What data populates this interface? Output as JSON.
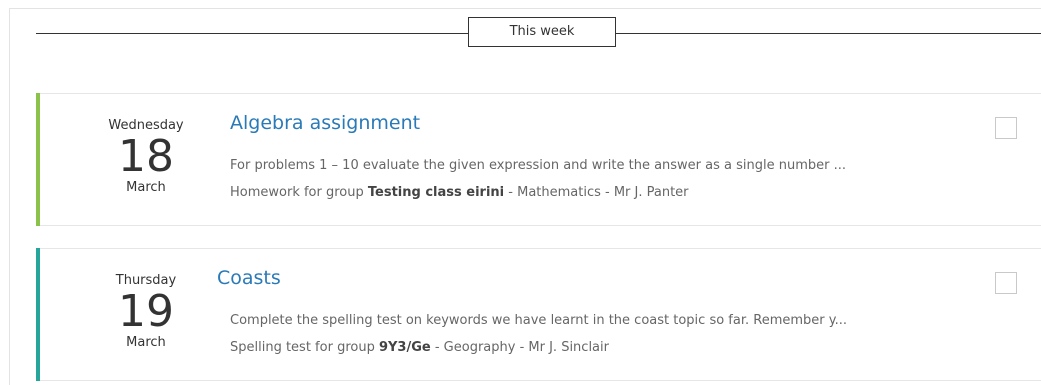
{
  "section": {
    "label": "This week"
  },
  "assignments": [
    {
      "dow": "Wednesday",
      "day": "18",
      "month": "March",
      "title": "Algebra assignment",
      "description": "For problems 1 – 10 evaluate the given expression and write the answer as a single number ...",
      "type_prefix": "Homework for group ",
      "group": "Testing class eirini",
      "subject_suffix": " - Mathematics - Mr J. Panter",
      "accent_color": "#8bc34a"
    },
    {
      "dow": "Thursday",
      "day": "19",
      "month": "March",
      "title": "Coasts",
      "description": "Complete the spelling test on keywords we have learnt in the coast topic so far. Remember y...",
      "type_prefix": "Spelling test for group ",
      "group": "9Y3/Ge",
      "subject_suffix": " - Geography - Mr J. Sinclair",
      "accent_color": "#26a69a"
    }
  ]
}
